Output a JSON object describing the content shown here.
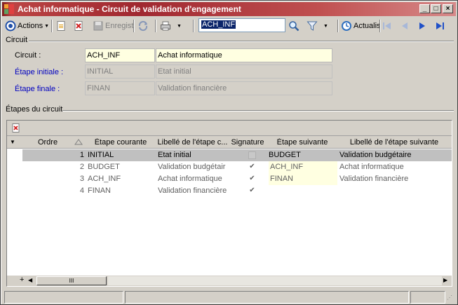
{
  "window": {
    "title": "Achat informatique - Circuit de validation d'engagement",
    "controls": [
      "_",
      "□",
      "×"
    ]
  },
  "toolbar": {
    "actions_label": "Actions",
    "save_label": "Enregist",
    "search_value": "ACH_INF",
    "refresh_label": "Actualis"
  },
  "circuit_section": {
    "title": "Circuit",
    "circuit_label": "Circuit :",
    "circuit_code": "ACH_INF",
    "circuit_name": "Achat informatique",
    "initial_label": "Étape initiale :",
    "initial_code": "INITIAL",
    "initial_name": "Etat initial",
    "final_label": "Étape finale :",
    "final_code": "FINAN",
    "final_name": "Validation financière"
  },
  "steps_section": {
    "title": "Étapes du circuit",
    "columns": [
      "Ordre",
      "Étape courante",
      "Libellé de l'étape c...",
      "Signature",
      "Étape suivante",
      "Libellé de l'étape suivante"
    ],
    "rows": [
      {
        "ordre": "1",
        "etape": "INITIAL",
        "libelle": "Etat initial",
        "signature": false,
        "suivante": "BUDGET",
        "libelle_suivante": "Validation budgétaire"
      },
      {
        "ordre": "2",
        "etape": "BUDGET",
        "libelle": "Validation budgétair",
        "signature": true,
        "suivante": "ACH_INF",
        "libelle_suivante": "Achat informatique"
      },
      {
        "ordre": "3",
        "etape": "ACH_INF",
        "libelle": "Achat informatique",
        "signature": true,
        "suivante": "FINAN",
        "libelle_suivante": "Validation financière"
      },
      {
        "ordre": "4",
        "etape": "FINAN",
        "libelle": "Validation financière",
        "signature": true,
        "suivante": "",
        "libelle_suivante": ""
      }
    ],
    "scroll_grip": "III",
    "add_label": "+"
  },
  "colors": {
    "title_start": "#7f1d1d",
    "selected_row": "#c0c0c0",
    "yellow_field": "#ffffe1",
    "blue_label": "#0000c0"
  }
}
